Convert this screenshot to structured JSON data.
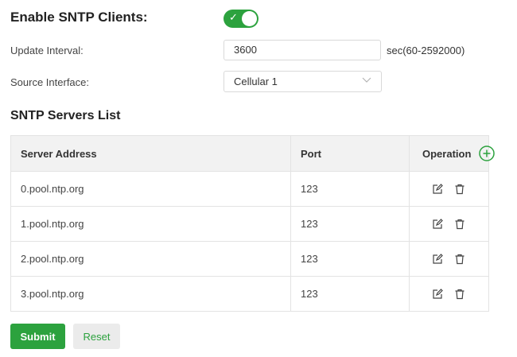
{
  "enable": {
    "label": "Enable SNTP Clients:",
    "enabled": true
  },
  "update_interval": {
    "label": "Update Interval:",
    "value": "3600",
    "unit": "sec(60-2592000)"
  },
  "source_interface": {
    "label": "Source Interface:",
    "value": "Cellular 1"
  },
  "servers": {
    "title": "SNTP Servers List",
    "columns": [
      "Server Address",
      "Port",
      "Operation"
    ],
    "rows": [
      {
        "address": "0.pool.ntp.org",
        "port": "123"
      },
      {
        "address": "1.pool.ntp.org",
        "port": "123"
      },
      {
        "address": "2.pool.ntp.org",
        "port": "123"
      },
      {
        "address": "3.pool.ntp.org",
        "port": "123"
      }
    ]
  },
  "buttons": {
    "submit": "Submit",
    "reset": "Reset"
  },
  "icons": {
    "toggle_check": "check-icon",
    "dropdown": "chevron-down-icon",
    "add": "plus-circle-icon",
    "edit": "edit-icon",
    "delete": "trash-icon"
  },
  "colors": {
    "accent": "#2ca23e",
    "header_bg": "#f2f2f2",
    "border": "#e3e3e3"
  }
}
